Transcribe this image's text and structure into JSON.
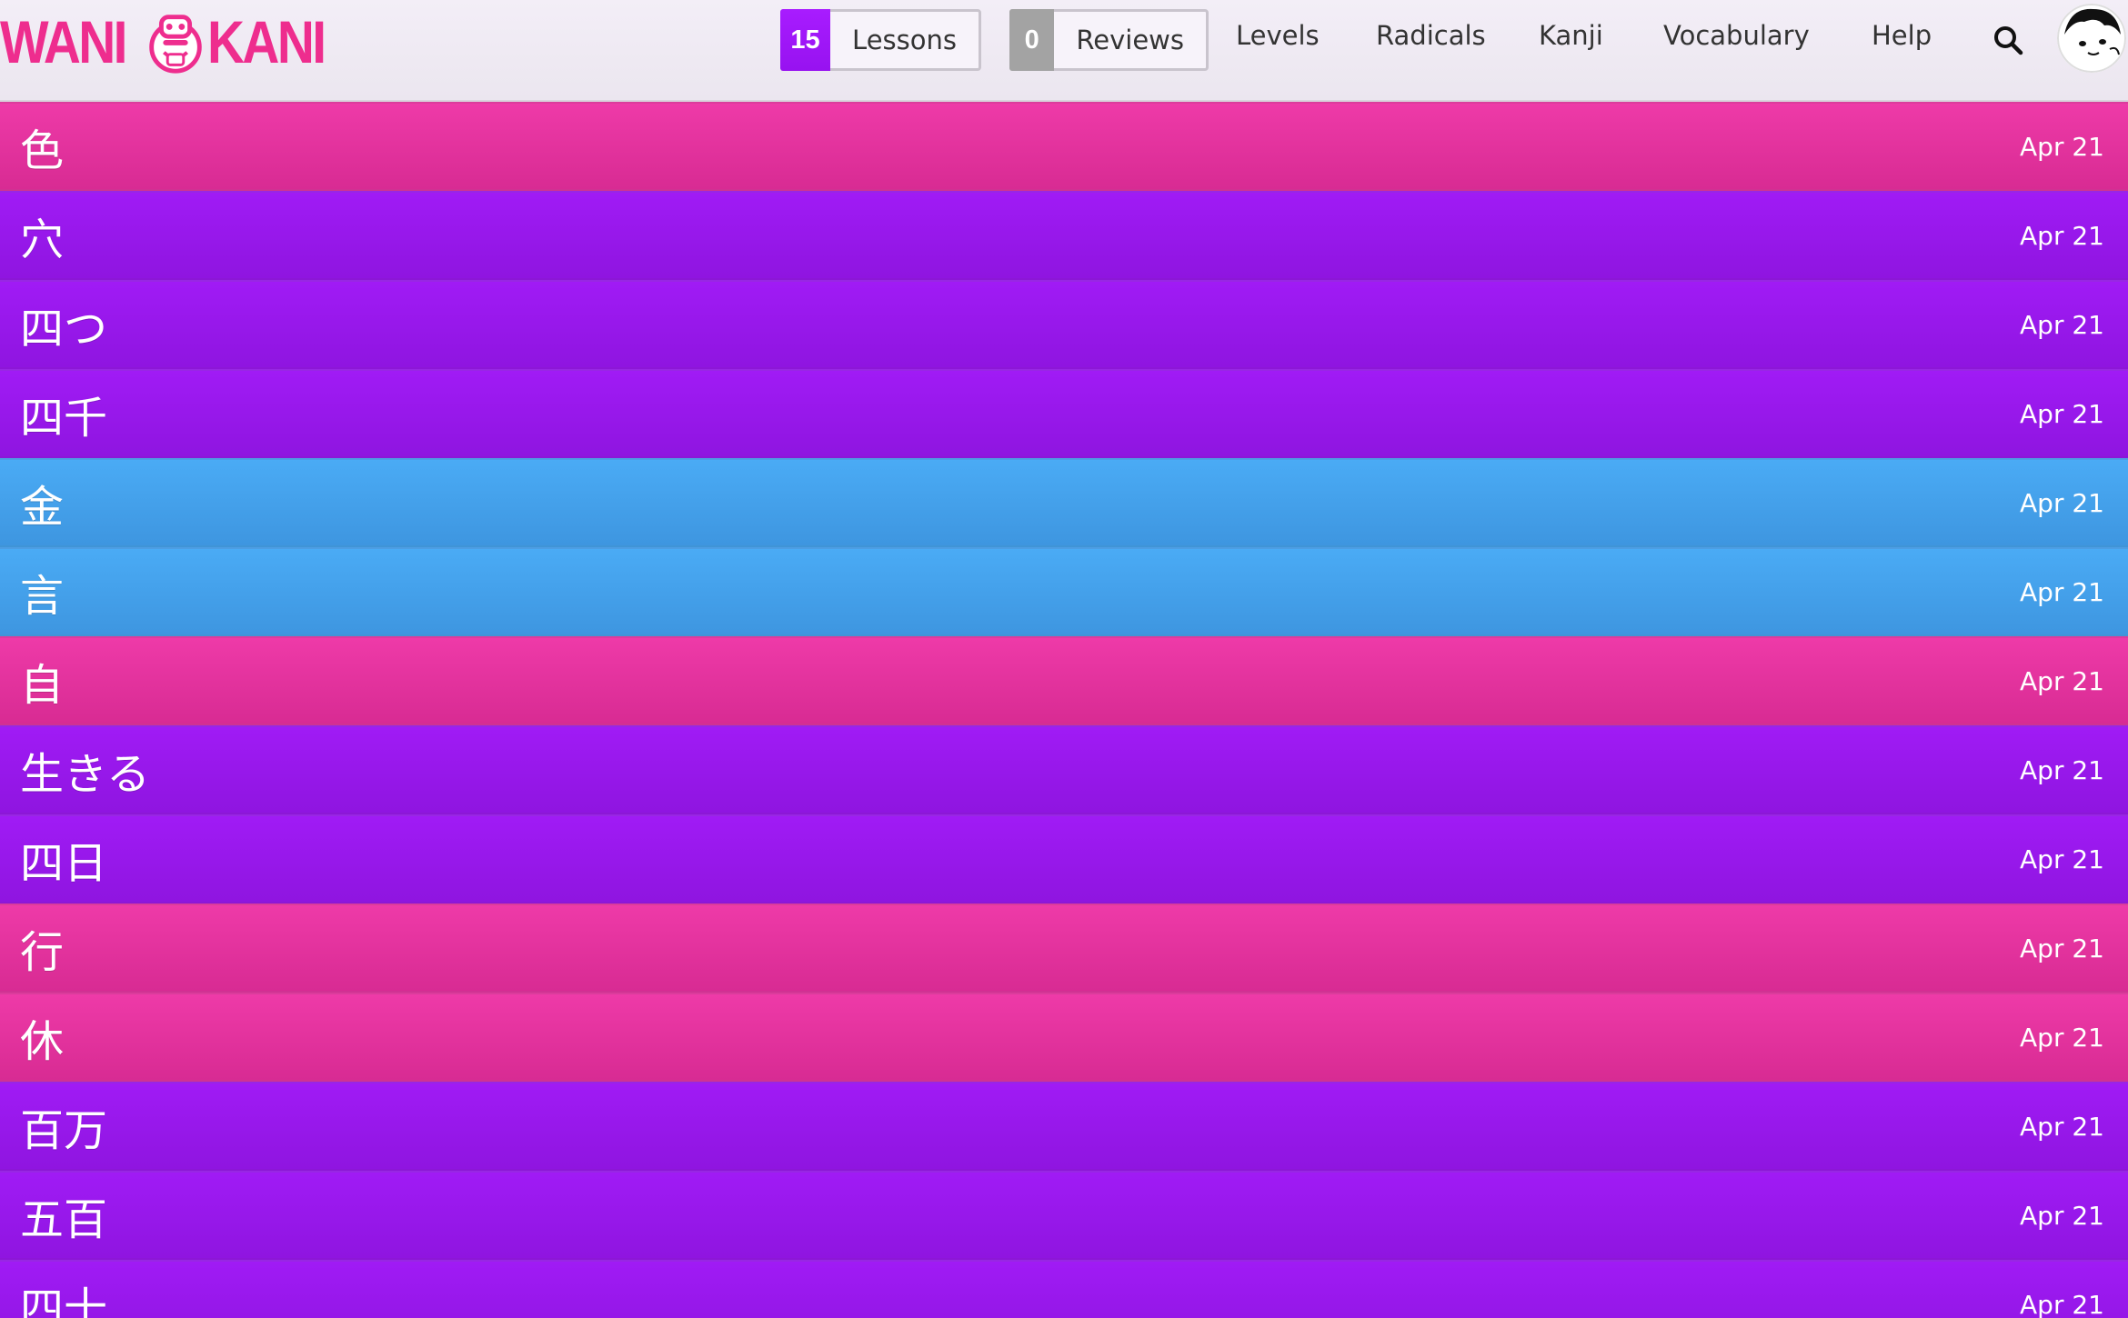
{
  "header": {
    "logo": {
      "left": "WANI",
      "right": "KANI"
    },
    "lessons": {
      "count": "15",
      "label": "Lessons"
    },
    "reviews": {
      "count": "0",
      "label": "Reviews"
    },
    "nav": [
      "Levels",
      "Radicals",
      "Kanji",
      "Vocabulary",
      "Help"
    ],
    "search_icon": "search-icon",
    "avatar_icon": "user-avatar"
  },
  "colors": {
    "kanji": "#e7329e",
    "vocabulary": "#9a18ec",
    "blue": "#45a2ec",
    "lessons_badge": "#a01bf5",
    "reviews_badge": "#a3a3a3",
    "logo": "#ee2d8e"
  },
  "items": [
    {
      "characters": "色",
      "date": "Apr 21",
      "type": "kanji"
    },
    {
      "characters": "穴",
      "date": "Apr 21",
      "type": "vocab"
    },
    {
      "characters": "四つ",
      "date": "Apr 21",
      "type": "vocab"
    },
    {
      "characters": "四千",
      "date": "Apr 21",
      "type": "vocab"
    },
    {
      "characters": "金",
      "date": "Apr 21",
      "type": "blue"
    },
    {
      "characters": "言",
      "date": "Apr 21",
      "type": "blue"
    },
    {
      "characters": "自",
      "date": "Apr 21",
      "type": "kanji"
    },
    {
      "characters": "生きる",
      "date": "Apr 21",
      "type": "vocab"
    },
    {
      "characters": "四日",
      "date": "Apr 21",
      "type": "vocab"
    },
    {
      "characters": "行",
      "date": "Apr 21",
      "type": "kanji"
    },
    {
      "characters": "休",
      "date": "Apr 21",
      "type": "kanji"
    },
    {
      "characters": "百万",
      "date": "Apr 21",
      "type": "vocab"
    },
    {
      "characters": "五百",
      "date": "Apr 21",
      "type": "vocab"
    },
    {
      "characters": "四十",
      "date": "Apr 21",
      "type": "vocab"
    }
  ]
}
